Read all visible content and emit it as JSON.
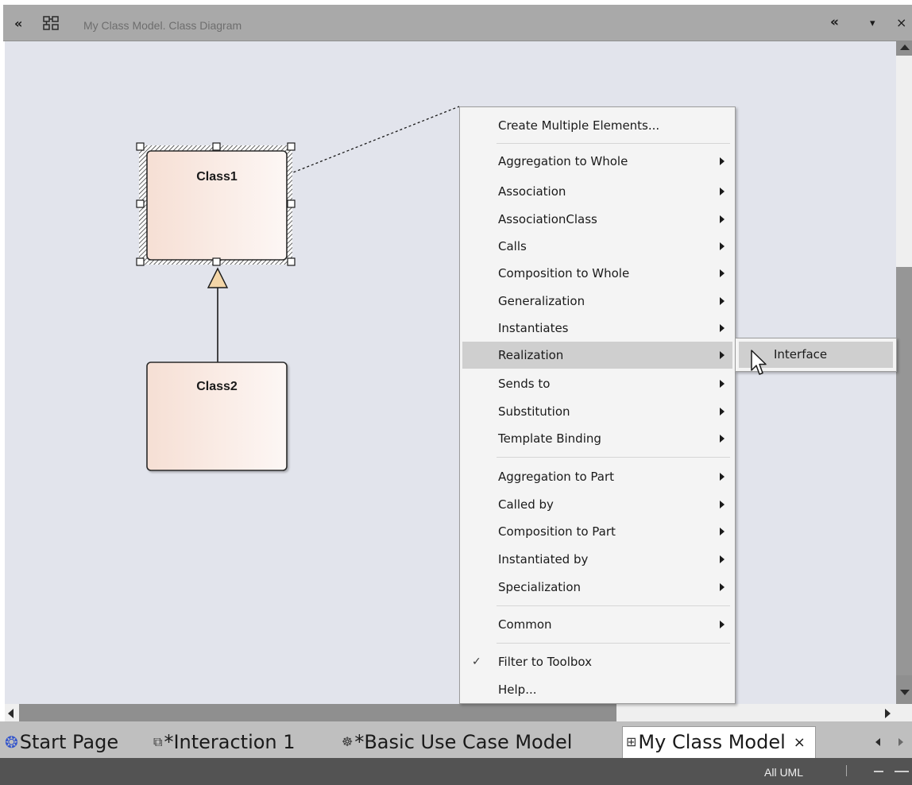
{
  "window": {
    "title": "My Class Model.  Class Diagram"
  },
  "titlebar": {
    "collapse_left_glyph": "«",
    "diagram_icon": "class-diagram-icon",
    "collapse_right_glyph": "«",
    "dropdown_glyph": "▾",
    "close_glyph": "×"
  },
  "diagram": {
    "classes": [
      {
        "name": "Class1",
        "selected": true
      },
      {
        "name": "Class2",
        "selected": false
      }
    ],
    "relationship": "Generalization",
    "colors": {
      "canvas": "#e2e4ec",
      "class_fill_left": "#f6dfd4",
      "class_fill_right": "#fdf7f5",
      "arrowhead_fill": "#f4d6a8"
    }
  },
  "context_menu": {
    "items": [
      {
        "label": "Create Multiple Elements...",
        "submenu": false
      },
      {
        "label": "Aggregation to Whole",
        "submenu": true
      },
      {
        "label": "Association",
        "submenu": true
      },
      {
        "label": "AssociationClass",
        "submenu": true
      },
      {
        "label": "Calls",
        "submenu": true
      },
      {
        "label": "Composition to Whole",
        "submenu": true
      },
      {
        "label": "Generalization",
        "submenu": true
      },
      {
        "label": "Instantiates",
        "submenu": true
      },
      {
        "label": "Realization",
        "submenu": true,
        "highlighted": true
      },
      {
        "label": "Sends to",
        "submenu": true
      },
      {
        "label": "Substitution",
        "submenu": true
      },
      {
        "label": "Template Binding",
        "submenu": true
      },
      {
        "label": "Aggregation to Part",
        "submenu": true
      },
      {
        "label": "Called by",
        "submenu": true
      },
      {
        "label": "Composition to Part",
        "submenu": true
      },
      {
        "label": "Instantiated by",
        "submenu": true
      },
      {
        "label": "Specialization",
        "submenu": true
      },
      {
        "label": "Common",
        "submenu": true
      },
      {
        "label": "Filter to Toolbox",
        "submenu": false,
        "checked": true
      },
      {
        "label": "Help...",
        "submenu": false
      }
    ],
    "submenu": {
      "items": [
        {
          "label": "Interface",
          "highlighted": true
        }
      ]
    }
  },
  "tabs": [
    {
      "label": "Start Page",
      "icon": "start-page-icon",
      "active": false
    },
    {
      "label": "*Interaction 1",
      "icon": "interaction-diagram-icon",
      "active": false
    },
    {
      "label": "*Basic Use Case Model",
      "icon": "use-case-diagram-icon",
      "active": false
    },
    {
      "label": "My Class Model",
      "icon": "class-diagram-icon",
      "active": true
    }
  ],
  "tab_close_glyph": "×",
  "status_bar": {
    "perspective": "All UML"
  }
}
